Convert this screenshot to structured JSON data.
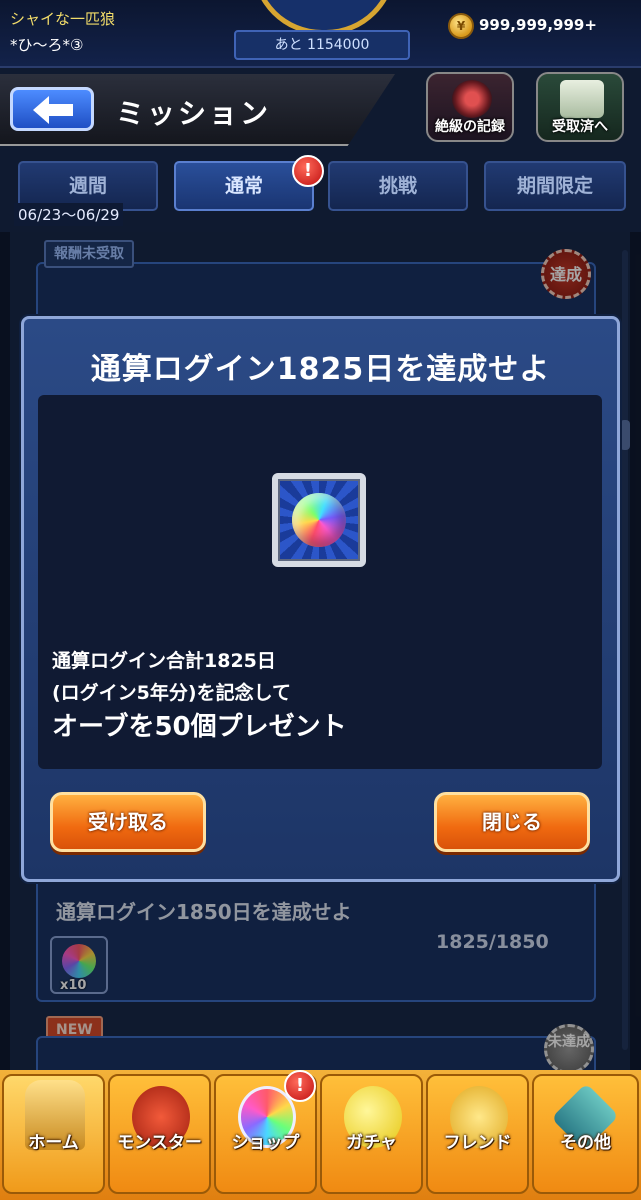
{
  "status": {
    "player_title": "シャイな一匹狼",
    "player_name": "*ひ〜ろ*③",
    "exp_remaining": "あと 1154000",
    "coin_symbol": "¥",
    "coin_value": "999,999,999+"
  },
  "header": {
    "title": "ミッション",
    "record_label": "絶級の記録",
    "received_label": "受取済へ"
  },
  "tabs": {
    "weekly": "週間",
    "normal": "通常",
    "challenge": "挑戦",
    "limited": "期間限定",
    "alert": "!",
    "week_range": "06/23〜06/29"
  },
  "list": {
    "badge_unclaimed": "報酬未受取",
    "stamp_achieved": "達成",
    "stamp_unachieved": "未達成",
    "card2_title": "通算ログイン1850日を達成せよ",
    "card2_progress": "1825/1850",
    "card2_qty": "x10",
    "badge_new": "NEW"
  },
  "dialog": {
    "title": "通算ログイン1825日を達成せよ",
    "line1": "通算ログイン合計1825日",
    "line2": "(ログイン5年分)を記念して",
    "line3": "オーブを50個プレゼント",
    "receive_label": "受け取る",
    "close_label": "閉じる"
  },
  "nav": {
    "home": "ホーム",
    "monster": "モンスター",
    "shop": "ショップ",
    "gacha": "ガチャ",
    "friend": "フレンド",
    "other": "その他",
    "shop_alert": "!"
  },
  "colors": {
    "accent": "#f08a12",
    "panel": "#1d3566",
    "alert": "#c01010"
  }
}
